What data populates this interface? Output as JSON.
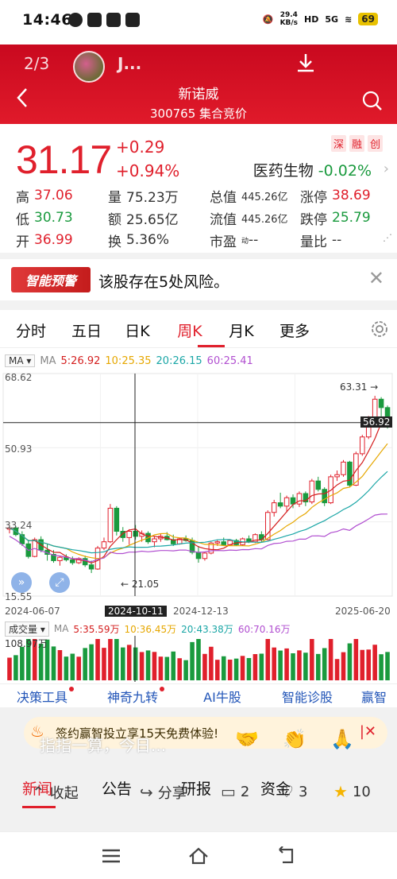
{
  "status_bar": {
    "time": "14:46",
    "net_speed": "29.4",
    "net_unit": "KB/s",
    "hd": "HD",
    "signal": "5G",
    "battery": "69"
  },
  "overlay": {
    "page_indicator": "2/3",
    "user_name": "J..."
  },
  "header": {
    "stock_name": "新诺威",
    "stock_code_status": "300765 集合竞价"
  },
  "quote": {
    "price": "31.17",
    "change": "+0.29",
    "change_pct": "+0.94%",
    "tags": [
      "深",
      "融",
      "创"
    ],
    "sector_name": "医药生物",
    "sector_change": "-0.02%",
    "stats": [
      [
        {
          "label": "高",
          "value": "37.06",
          "tone": "up"
        },
        {
          "label": "量",
          "value": "75.23万",
          "tone": "neu"
        },
        {
          "label": "总值",
          "value": "445.26亿",
          "tone": "neu",
          "small": true
        },
        {
          "label": "涨停",
          "value": "38.69",
          "tone": "up"
        }
      ],
      [
        {
          "label": "低",
          "value": "30.73",
          "tone": "down"
        },
        {
          "label": "额",
          "value": "25.65亿",
          "tone": "neu"
        },
        {
          "label": "流值",
          "value": "445.26亿",
          "tone": "neu",
          "small": true
        },
        {
          "label": "跌停",
          "value": "25.79",
          "tone": "down"
        }
      ],
      [
        {
          "label": "开",
          "value": "36.99",
          "tone": "up"
        },
        {
          "label": "换",
          "value": "5.36%",
          "tone": "neu"
        },
        {
          "label": "市盈",
          "value": "--",
          "tone": "neu",
          "sup": "动"
        },
        {
          "label": "量比",
          "value": "--",
          "tone": "neu"
        }
      ]
    ]
  },
  "warning": {
    "badge": "智能预警",
    "message": "该股存在5处风险。"
  },
  "chart_tabs": [
    {
      "label": "分时",
      "active": false
    },
    {
      "label": "五日",
      "active": false
    },
    {
      "label": "日K",
      "active": false
    },
    {
      "label": "周K",
      "active": true
    },
    {
      "label": "月K",
      "active": false
    },
    {
      "label": "更多",
      "active": false
    }
  ],
  "ma": {
    "selector": "MA",
    "label": "MA",
    "ma5": "5:26.92",
    "ma10": "10:25.35",
    "ma20": "20:26.15",
    "ma60": "60:25.41"
  },
  "chart_labels": {
    "y_top": "68.62",
    "y_mid1": "50.93",
    "y_mid2": "33.24",
    "y_bottom": "15.55",
    "high_marker": "63.31",
    "cross_price": "56.92",
    "low_marker": "21.05",
    "x_dates": [
      "2024-06-07",
      "2024-10-11",
      "2024-12-13",
      "2025-06-20"
    ]
  },
  "volume": {
    "selector": "成交量",
    "label": "MA",
    "ma5": "5:35.59万",
    "ma10": "10:36.45万",
    "ma20": "20:43.38万",
    "ma60": "60:70.16万",
    "max": "108.97万"
  },
  "tools": [
    {
      "label": "决策工具",
      "dot": true
    },
    {
      "label": "神奇九转",
      "dot": true
    },
    {
      "label": "AI牛股",
      "dot": false
    },
    {
      "label": "智能诊股",
      "dot": false
    },
    {
      "label": "赢智",
      "dot": false
    }
  ],
  "promo": {
    "text": "签约赢智投立享15天免费体验!"
  },
  "comment_placeholder": "指指一算，今日...",
  "news_tabs": [
    "新闻",
    "公告",
    "研报",
    "资金"
  ],
  "actions": {
    "collapse": "收起",
    "share": "分享",
    "comments": "2",
    "likes": "3",
    "stars": "10"
  },
  "colors": {
    "red": "#e0202c",
    "green": "#1a9a3e",
    "header": "#d51024"
  },
  "chart_data": {
    "type": "candlestick",
    "title": "",
    "period": "weekly",
    "ylim": [
      15.55,
      68.62
    ],
    "x_ticks": [
      "2024-06-07",
      "2024-10-11",
      "2024-12-13",
      "2025-06-20"
    ],
    "annotations": {
      "high": 63.31,
      "low": 21.05,
      "crosshair_price": 56.92,
      "crosshair_date": "2024-10-11"
    },
    "moving_averages": {
      "MA5": 26.92,
      "MA10": 25.35,
      "MA20": 26.15,
      "MA60": 25.41
    },
    "candles": [
      [
        31.5,
        32.5,
        30.5,
        31.8
      ],
      [
        31.8,
        32.2,
        29.8,
        30.2
      ],
      [
        30.2,
        31.0,
        27.5,
        28.0
      ],
      [
        28.0,
        29.0,
        24.5,
        25.0
      ],
      [
        25.0,
        29.5,
        24.8,
        29.0
      ],
      [
        29.0,
        29.8,
        26.0,
        26.5
      ],
      [
        26.5,
        28.0,
        24.0,
        25.5
      ],
      [
        25.5,
        26.5,
        23.5,
        24.0
      ],
      [
        24.0,
        25.2,
        22.8,
        24.8
      ],
      [
        24.8,
        25.5,
        23.8,
        24.2
      ],
      [
        24.2,
        25.0,
        23.0,
        23.5
      ],
      [
        23.5,
        24.8,
        23.2,
        24.5
      ],
      [
        24.5,
        25.2,
        22.5,
        23.0
      ],
      [
        23.0,
        24.0,
        21.05,
        22.0
      ],
      [
        22.0,
        27.5,
        21.8,
        27.0
      ],
      [
        27.0,
        29.5,
        26.5,
        28.5
      ],
      [
        28.5,
        37.5,
        28.2,
        36.5
      ],
      [
        36.5,
        37.0,
        30.0,
        31.0
      ],
      [
        31.0,
        32.0,
        28.5,
        29.5
      ],
      [
        29.5,
        31.5,
        27.8,
        31.0
      ],
      [
        31.0,
        32.5,
        29.0,
        29.8
      ],
      [
        29.8,
        31.2,
        28.5,
        30.5
      ],
      [
        30.5,
        31.0,
        28.0,
        28.5
      ],
      [
        28.5,
        29.8,
        27.2,
        29.2
      ],
      [
        29.2,
        30.5,
        28.5,
        29.8
      ],
      [
        29.8,
        30.8,
        28.8,
        29.0
      ],
      [
        29.0,
        30.2,
        27.5,
        28.0
      ],
      [
        28.0,
        29.5,
        27.8,
        29.2
      ],
      [
        29.2,
        30.0,
        28.5,
        28.8
      ],
      [
        28.8,
        29.5,
        25.5,
        26.0
      ],
      [
        26.0,
        27.5,
        23.5,
        24.5
      ],
      [
        24.5,
        26.0,
        24.0,
        25.8
      ],
      [
        25.8,
        28.5,
        25.5,
        28.2
      ],
      [
        28.2,
        29.0,
        27.5,
        28.5
      ],
      [
        28.5,
        29.5,
        27.5,
        27.8
      ],
      [
        27.8,
        29.0,
        27.5,
        28.8
      ],
      [
        28.8,
        29.2,
        27.5,
        27.8
      ],
      [
        27.8,
        29.5,
        27.5,
        29.2
      ],
      [
        29.2,
        30.0,
        28.2,
        28.5
      ],
      [
        28.5,
        30.5,
        28.2,
        30.2
      ],
      [
        30.2,
        31.0,
        28.5,
        29.0
      ],
      [
        29.0,
        36.0,
        28.8,
        35.5
      ],
      [
        35.5,
        38.5,
        34.5,
        37.8
      ],
      [
        37.8,
        40.2,
        36.5,
        37.0
      ],
      [
        37.0,
        39.5,
        35.5,
        39.0
      ],
      [
        39.0,
        39.8,
        36.5,
        37.5
      ],
      [
        37.5,
        40.5,
        36.8,
        40.0
      ],
      [
        40.0,
        40.5,
        37.0,
        38.0
      ],
      [
        38.0,
        43.5,
        37.5,
        43.0
      ],
      [
        43.0,
        44.0,
        40.5,
        41.0
      ],
      [
        41.0,
        41.5,
        37.0,
        37.8
      ],
      [
        37.8,
        44.5,
        37.5,
        44.0
      ],
      [
        44.0,
        45.5,
        43.0,
        44.5
      ],
      [
        44.5,
        48.0,
        44.0,
        47.5
      ],
      [
        47.5,
        47.8,
        41.5,
        42.0
      ],
      [
        42.0,
        50.0,
        41.8,
        49.5
      ],
      [
        49.5,
        54.0,
        49.0,
        53.5
      ],
      [
        53.5,
        58.5,
        53.0,
        58.0
      ],
      [
        58.0,
        63.31,
        56.0,
        62.5
      ],
      [
        62.5,
        63.0,
        58.0,
        60.5
      ],
      [
        60.5,
        61.0,
        55.5,
        56.92
      ]
    ],
    "volume_max": "108.97万"
  }
}
